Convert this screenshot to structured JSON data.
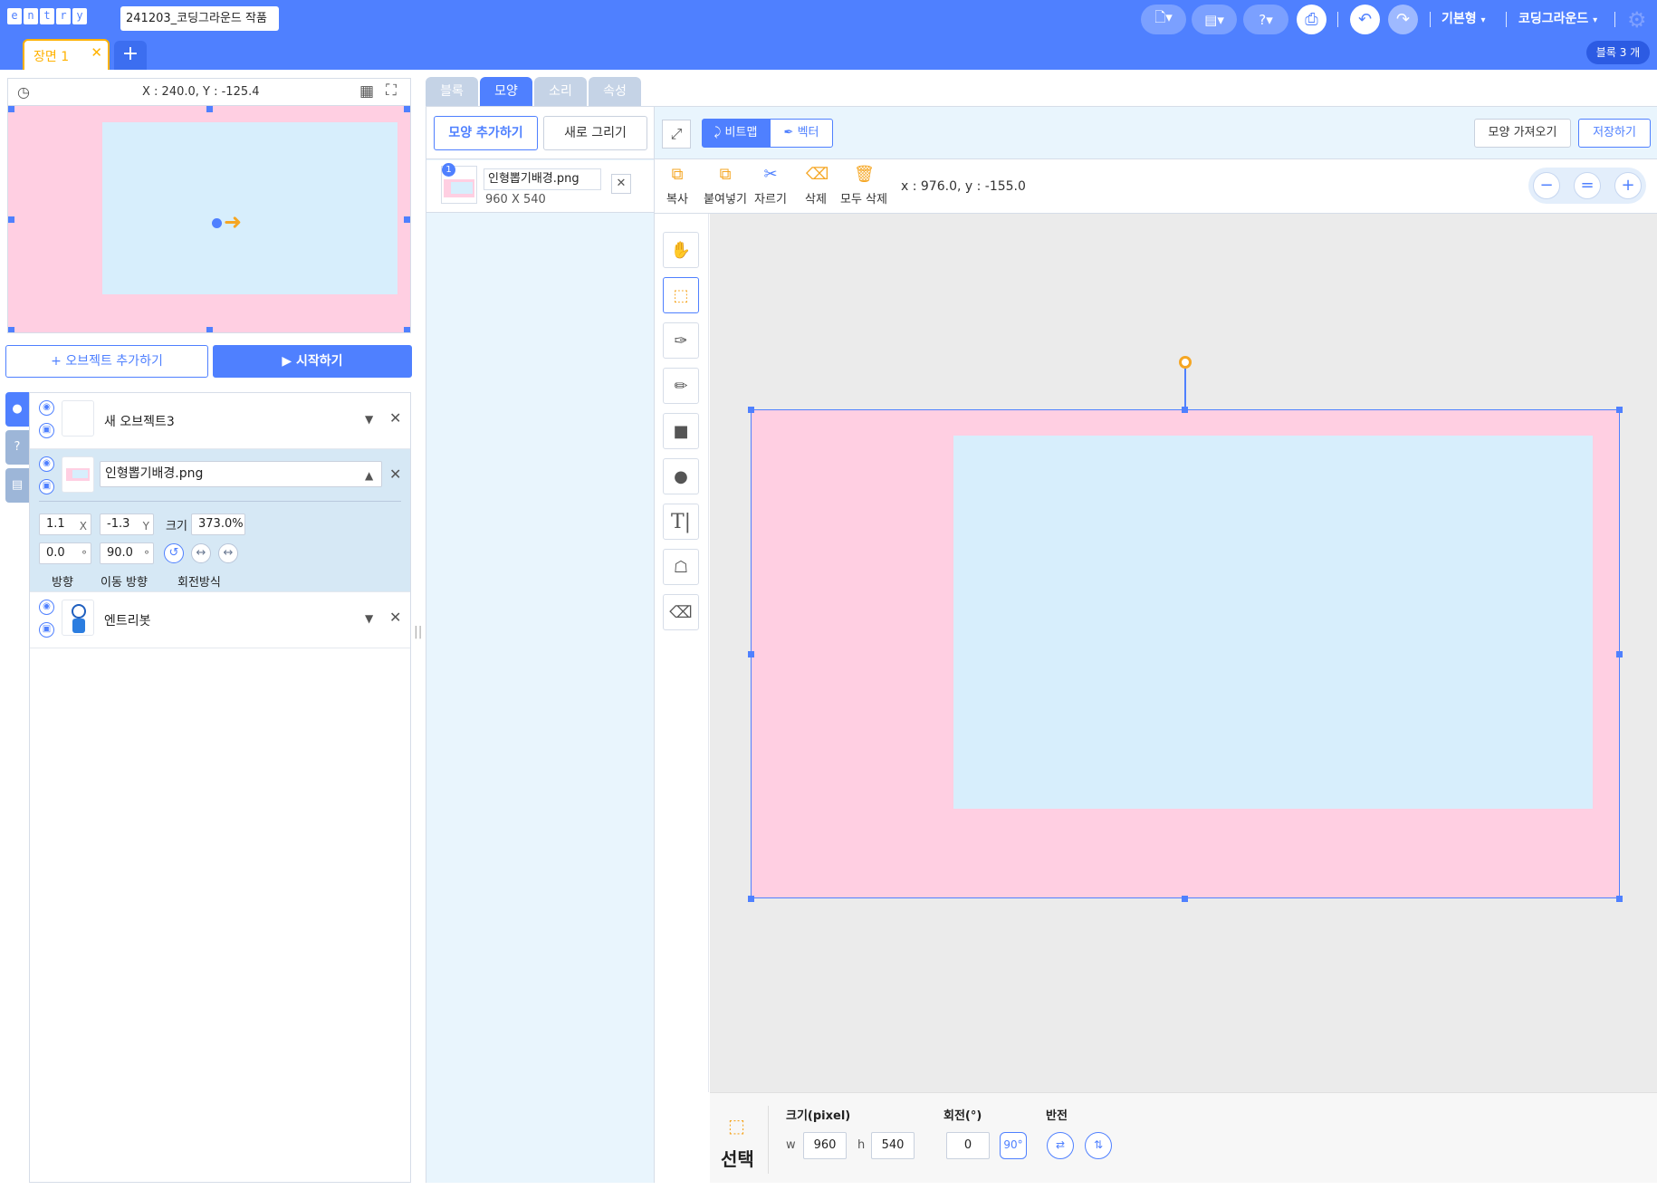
{
  "app": {
    "logo_letters": [
      "e",
      "n",
      "t",
      "r",
      "y"
    ],
    "project_title": "241203_코딩그라운드 작품",
    "mode_label": "기본형",
    "user_label": "코딩그라운드",
    "block_count": "블록 3 개"
  },
  "scenes": {
    "active_tab": "장면 1"
  },
  "stage": {
    "coords": "X : 240.0, Y : -125.4"
  },
  "actions": {
    "add_object": "+ 오브젝트 추가하기",
    "start": "▶ 시작하기"
  },
  "objects": [
    {
      "name": "새 오브젝트3"
    },
    {
      "name": "인형뽑기배경.png",
      "x": "1.1",
      "x_suffix": "X",
      "y": "-1.3",
      "y_suffix": "Y",
      "size_label": "크기",
      "size": "373.0%",
      "direction": "0.0",
      "move_direction": "90.0",
      "direction_label": "방향",
      "move_direction_label": "이동 방향",
      "rotation_label": "회전방식",
      "degree": "°"
    },
    {
      "name": "엔트리봇"
    }
  ],
  "main_tabs": [
    "블록",
    "모양",
    "소리",
    "속성"
  ],
  "shape_panel": {
    "add_shape": "모양 추가하기",
    "new_draw": "새로 그리기",
    "item_index": "1",
    "item_name": "인형뽑기배경.png",
    "item_size": "960 X 540"
  },
  "editor": {
    "bitmap": "비트맵",
    "vector": "벡터",
    "import_shape": "모양 가져오기",
    "save": "저장하기",
    "tools": [
      "복사",
      "붙여넣기",
      "자르기",
      "삭제",
      "모두 삭제"
    ],
    "coords": "x : 976.0, y : -155.0",
    "zoom_minus": "−",
    "zoom_reset": "=",
    "zoom_plus": "+"
  },
  "bottom": {
    "tool_name": "선택",
    "size_label": "크기(pixel)",
    "w_label": "w",
    "w": "960",
    "h_label": "h",
    "h": "540",
    "rotate_label": "회전(°)",
    "rotate": "0",
    "rotate_90": "90°",
    "flip_label": "반전"
  },
  "colors": {
    "brand": "#4f80ff",
    "scene_accent": "#ffb200",
    "bg_pink": "#ffcfe2",
    "bg_blue": "#d7eefc"
  }
}
